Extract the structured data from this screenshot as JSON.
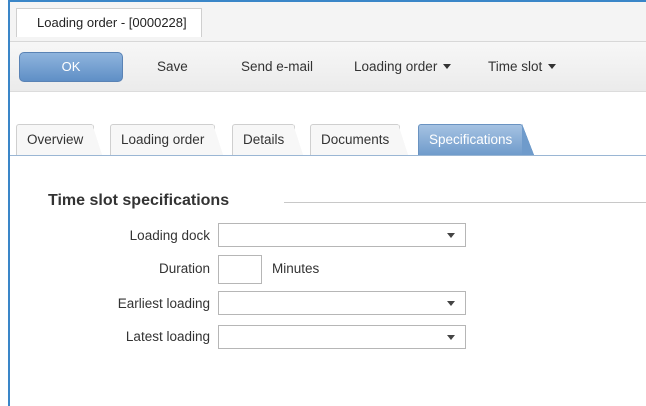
{
  "window": {
    "title": "Loading order - [0000228]"
  },
  "toolbar": {
    "ok_label": "OK",
    "save_label": "Save",
    "send_email_label": "Send e-mail",
    "loading_order_label": "Loading order",
    "time_slot_label": "Time slot"
  },
  "tabs": {
    "overview": "Overview",
    "loading_order": "Loading order",
    "details": "Details",
    "documents": "Documents",
    "specifications": "Specifications",
    "active": "Specifications"
  },
  "section": {
    "title": "Time slot specifications"
  },
  "form": {
    "loading_dock": {
      "label": "Loading dock",
      "value": ""
    },
    "duration": {
      "label": "Duration",
      "value": "",
      "unit": "Minutes"
    },
    "earliest_loading": {
      "label": "Earliest loading",
      "value": ""
    },
    "latest_loading": {
      "label": "Latest loading",
      "value": ""
    }
  },
  "colors": {
    "accent": "#6f9bcb",
    "window_border": "#3a86c8"
  }
}
